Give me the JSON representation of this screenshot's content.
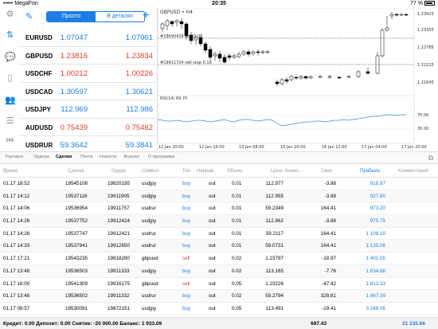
{
  "status": {
    "carrier": "••••• MegaFon",
    "time": "20:35",
    "battery": "77 %"
  },
  "quotes": {
    "mode_simple": "Просто",
    "mode_detail": "В деталях",
    "rows": [
      {
        "symbol": "EURUSD",
        "bid": "1.07047",
        "ask": "1.07061",
        "color": "#1e7de4"
      },
      {
        "symbol": "GBPUSD",
        "bid": "1.23816",
        "ask": "1.23834",
        "color": "#e23b2e"
      },
      {
        "symbol": "USDCHF",
        "bid": "1.00212",
        "ask": "1.00226",
        "color": "#e23b2e"
      },
      {
        "symbol": "USDCAD",
        "bid": "1.30597",
        "ask": "1.30621",
        "color": "#1e7de4"
      },
      {
        "symbol": "USDJPY",
        "bid": "112.969",
        "ask": "112.986",
        "color": "#1e7de4"
      },
      {
        "symbol": "AUDUSD",
        "bid": "0.75439",
        "ask": "0.75462",
        "color": "#e23b2e"
      },
      {
        "symbol": "USDRUR",
        "bid": "59.3642",
        "ask": "59.3841",
        "color": "#1e7de4"
      }
    ]
  },
  "sidebar": {
    "h4_label": "H4"
  },
  "chart": {
    "title": "GBPUSD • H4",
    "order1": "#19690438 buy 0.02",
    "order2": "#19911724 sell stop 0.16",
    "rsi_label": "RSI(14) 69.70",
    "price_ticks": [
      "1.23925",
      "1.23355",
      "1.22785",
      "1.22215",
      "1.21645"
    ],
    "rsi_ticks": [
      "70.00",
      "30.00"
    ],
    "time_ticks": [
      "12 Jan 20:00",
      "12 Jan 16:00",
      "13 Jan 08:00",
      "15 Jan 20:00",
      "16 Jan 12:00",
      "17 Jan 04:00",
      "17 Jan 20:00"
    ]
  },
  "tabs": [
    "Торговля",
    "Ордеры",
    "Сделки",
    "Почта",
    "Новости",
    "Журнал",
    "О программе"
  ],
  "table": {
    "headers": [
      "Время",
      "Сделка",
      "Ордер",
      "Символ",
      "Тип",
      "Направ...",
      "Объем",
      "Цена",
      "Комис...",
      "Своп",
      "Прибыль",
      "Комментарий"
    ],
    "rows": [
      [
        "01.17 18:52",
        "19545108",
        "19920195",
        "usdjpy",
        "buy",
        "out",
        "0.01",
        "112.977",
        "",
        "-3.88",
        "918.97"
      ],
      [
        "01.17 14:12",
        "19537116",
        "19911905",
        "usdjpy",
        "buy",
        "out",
        "0.01",
        "112.955",
        "",
        "-3.88",
        "927.80"
      ],
      [
        "01.17 14:06",
        "19536954",
        "19911757",
        "usdrur",
        "buy",
        "out",
        "0.01",
        "59.2349",
        "",
        "164.41",
        "973.20"
      ],
      [
        "01.17 14:26",
        "19537752",
        "19912424",
        "usdjpy",
        "buy",
        "out",
        "0.01",
        "112.862",
        "",
        "-3.88",
        "975.75"
      ],
      [
        "01.17 14:26",
        "19537747",
        "19912421",
        "usdrur",
        "buy",
        "out",
        "0.01",
        "59.2117",
        "",
        "164.41",
        "1 108.10"
      ],
      [
        "01.17 14:33",
        "19537941",
        "19912650",
        "usdrur",
        "buy",
        "out",
        "0.01",
        "59.0731",
        "",
        "164.41",
        "1 135.06"
      ],
      [
        "01.17 17:21",
        "19543235",
        "19918280",
        "gbpusd",
        "sell",
        "out",
        "0.02",
        "1.23797",
        "",
        "-18.97",
        "1 401.05"
      ],
      [
        "01.17 13:48",
        "19536503",
        "19911333",
        "usdjpy",
        "buy",
        "out",
        "0.02",
        "113.165",
        "",
        "-7.76",
        "1 634.88"
      ],
      [
        "01.17 16:00",
        "19541309",
        "19916175",
        "gbpusd",
        "sell",
        "out",
        "0.05",
        "1.23226",
        "",
        "-47.42",
        "1 813.33"
      ],
      [
        "01.17 13:48",
        "19536502",
        "19911332",
        "usdrur",
        "buy",
        "out",
        "0.02",
        "59.2794",
        "",
        "328.81",
        "1 867.39"
      ],
      [
        "01.17 08:57",
        "19530091",
        "19872151",
        "usdjpy",
        "buy",
        "out",
        "0.05",
        "113.491",
        "",
        "-19.41",
        "3 248.06"
      ]
    ]
  },
  "footer": {
    "summary": "Кредит: 0.00  Депозит: 0.00  Снятие: -20 000.00  Баланс: 1 933.09",
    "swap_total": "697.43",
    "profit_total": "21 235.66"
  }
}
